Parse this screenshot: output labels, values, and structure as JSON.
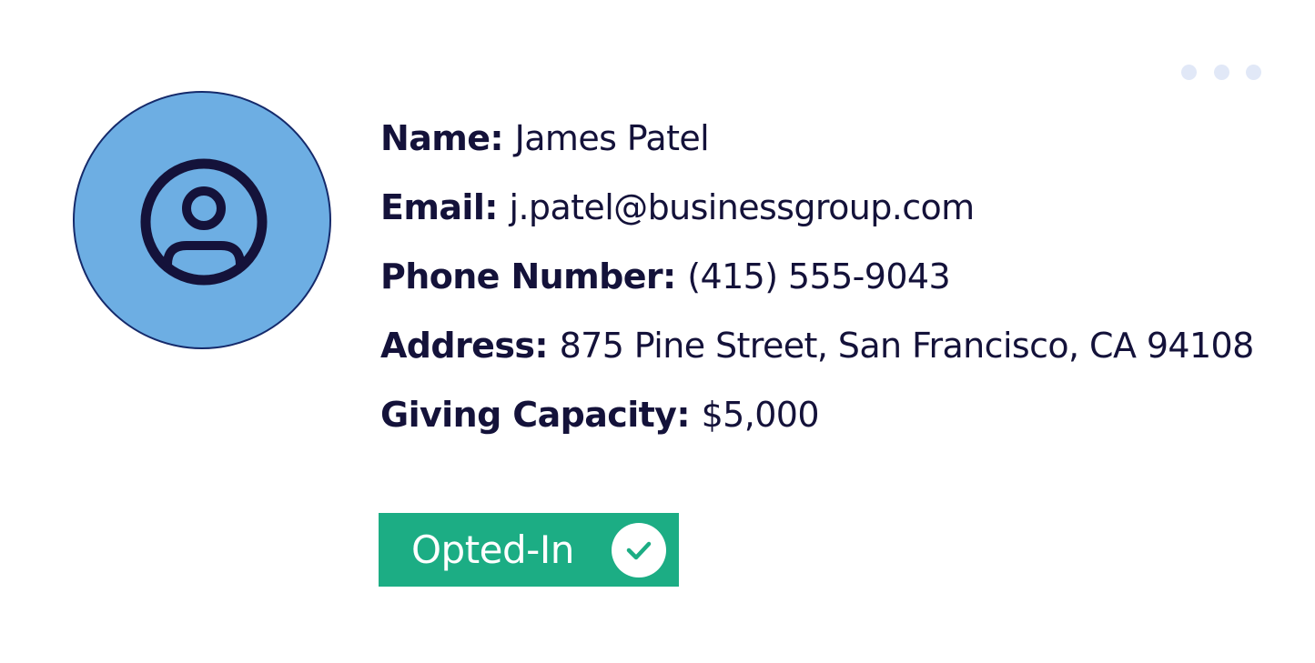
{
  "menu": {
    "icon": "more-horizontal-icon"
  },
  "avatar": {
    "icon": "user-circle-icon",
    "background": "#6daee3",
    "border": "#152a6b"
  },
  "contact": {
    "name": {
      "label": "Name:",
      "value": "James Patel"
    },
    "email": {
      "label": "Email:",
      "value": "j.patel@businessgroup.com"
    },
    "phone": {
      "label": "Phone Number:",
      "value": "(415) 555-9043"
    },
    "address": {
      "label": "Address:",
      "value": "875 Pine Street, San Francisco, CA 94108"
    },
    "giving_capacity": {
      "label": "Giving Capacity:",
      "value": "$5,000"
    }
  },
  "status_badge": {
    "label": "Opted-In",
    "icon": "check-circle-icon",
    "color": "#1cad84"
  }
}
